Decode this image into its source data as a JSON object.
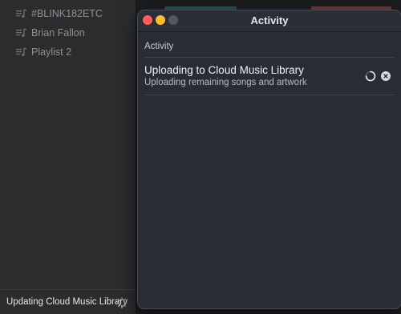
{
  "sidebar": {
    "playlists": [
      {
        "label": "#BLINK182ETC",
        "icon": "playlist-icon"
      },
      {
        "label": "Brian Fallon",
        "icon": "playlist-icon"
      },
      {
        "label": "Playlist 2",
        "icon": "playlist-icon"
      }
    ],
    "status": {
      "text": "Updating Cloud Music Library",
      "icon": "spinner-icon"
    }
  },
  "window": {
    "title": "Activity",
    "section_label": "Activity",
    "task": {
      "title": "Uploading to Cloud Music Library",
      "subtitle": "Uploading remaining songs and artwork"
    }
  },
  "colors": {
    "close": "#ff5f57",
    "minimize": "#febc2e",
    "window_bg": "#2a2c35",
    "sidebar_bg": "#2a2c2e"
  }
}
